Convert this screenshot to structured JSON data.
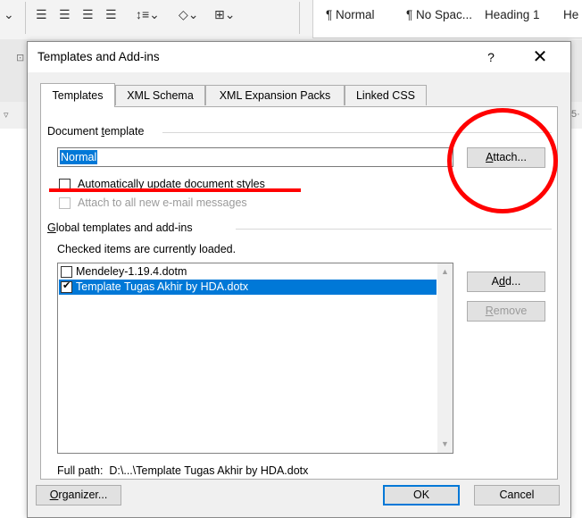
{
  "ribbon": {
    "styles": [
      "¶ Normal",
      "¶ No Spac...",
      "Heading 1",
      "He"
    ],
    "side_left": "▿",
    "side_right": "5·"
  },
  "dialog": {
    "title": "Templates and Add-ins",
    "help": "?",
    "close": "✕",
    "tabs": [
      {
        "label": "Templates",
        "active": true
      },
      {
        "label": "XML Schema",
        "active": false
      },
      {
        "label": "XML Expansion Packs",
        "active": false
      },
      {
        "label": "Linked CSS",
        "active": false
      }
    ],
    "document_template": {
      "label_pre": "Document ",
      "label_u": "t",
      "label_post": "emplate",
      "value": "Normal",
      "attach_pre": "",
      "attach_u": "A",
      "attach_post": "ttach..."
    },
    "auto_update": {
      "label_pre": "Automatically ",
      "label_u": "u",
      "label_post": "pdate document styles",
      "checked": false
    },
    "attach_email": {
      "label": "Attach to all new e-mail messages",
      "checked": false,
      "disabled": true
    },
    "global": {
      "label_u": "G",
      "label_post": "lobal templates and add-ins",
      "note": "Checked items are currently loaded.",
      "items": [
        {
          "label": "Mendeley-1.19.4.dotm",
          "checked": false,
          "selected": false
        },
        {
          "label": "Template Tugas Akhir by HDA.dotx",
          "checked": true,
          "selected": true
        }
      ],
      "add_pre": "A",
      "add_u": "d",
      "add_post": "d...",
      "remove_u": "R",
      "remove_post": "emove"
    },
    "full_path": {
      "label": "Full path:",
      "value": "D:\\...\\Template Tugas Akhir by HDA.dotx"
    },
    "footer": {
      "organizer_u": "O",
      "organizer_post": "rganizer...",
      "ok": "OK",
      "cancel": "Cancel"
    }
  },
  "colors": {
    "selection": "#0078d7",
    "annotation": "#ff0000"
  }
}
